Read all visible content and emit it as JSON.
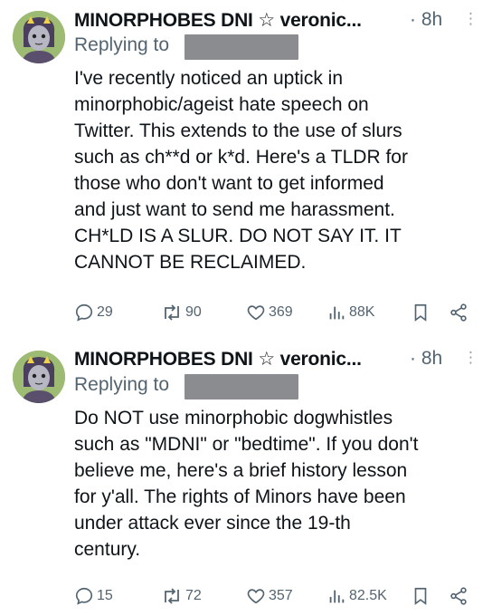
{
  "tweets": [
    {
      "author": "MINORPHOBES DNI ",
      "star": "☆",
      "handle": " veronic...",
      "time": "· 8h",
      "more": "⋮",
      "replying_to": "Replying to",
      "text": "I've recently noticed an uptick in\nminorphobic/ageist hate speech on\nTwitter. This extends to the use of slurs\nsuch as ch**d or k*d. Here's a TLDR for\nthose who don't want to get informed\nand just want to send me harassment.\nCH*LD IS A SLUR. DO NOT SAY IT. IT\nCANNOT BE RECLAIMED.",
      "replies": "29",
      "retweets": "90",
      "likes": "369",
      "views": "88K"
    },
    {
      "author": "MINORPHOBES DNI ",
      "star": "☆",
      "handle": " veronic...",
      "time": "· 8h",
      "more": "⋮",
      "replying_to": "Replying to",
      "text": "Do NOT use minorphobic dogwhistles\nsuch as \"MDNI\" or \"bedtime\". If you don't\nbelieve me, here's a brief history lesson\nfor y'all. The rights of Minors have been\nunder attack ever since the 19-th\ncentury.",
      "replies": "15",
      "retweets": "72",
      "likes": "357",
      "views": "82.5K"
    }
  ],
  "icons": [
    "reply-icon",
    "retweet-icon",
    "like-icon",
    "views-icon",
    "bookmark-icon",
    "share-icon"
  ],
  "colors": {
    "muted": "#536471",
    "text": "#0f1419",
    "redaction": "#8a8c8f",
    "avatar_bg": "#9dbb73"
  }
}
